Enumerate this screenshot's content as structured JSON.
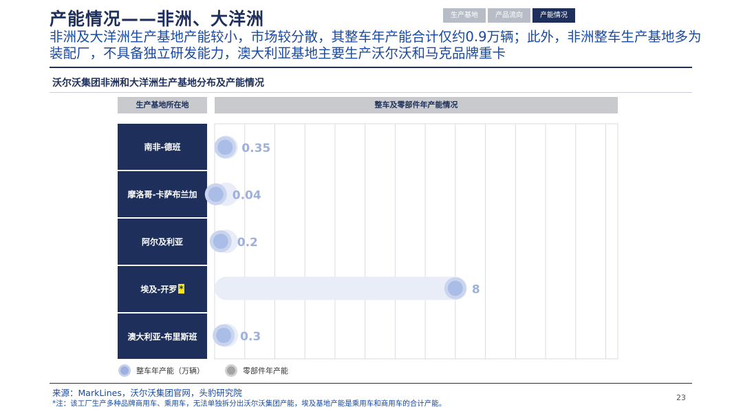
{
  "header": {
    "title": "产能情况——非洲、大洋洲",
    "nav_tabs": [
      {
        "label": "生产基地",
        "active": false
      },
      {
        "label": "产品流向",
        "active": false
      },
      {
        "label": "产能情况",
        "active": true
      }
    ],
    "subtitle": "非洲及大洋洲生产基地产能较小，市场较分散，其整车年产能合计仅约0.9万辆；此外，非洲整车生产基地多为装配厂，不具备独立研发能力，澳大利亚基地主要生产沃尔沃和马克品牌重卡"
  },
  "section_title": "沃尔沃集团非洲和大洋洲生产基地分布及产能情况",
  "table": {
    "col_left_header": "生产基地所在地",
    "col_right_header": "整车及零部件年产能情况"
  },
  "chart_data": {
    "type": "bar",
    "title": "",
    "xlabel": "",
    "ylabel": "",
    "categories": [
      "南非-德班",
      "摩洛哥-卡萨布兰加",
      "阿尔及利亚",
      "埃及-开罗",
      "澳大利亚-布里斯班"
    ],
    "category_notes": [
      "",
      "",
      "",
      "*",
      ""
    ],
    "series": [
      {
        "name": "整车年产能（万辆）",
        "values": [
          0.35,
          0.04,
          0.2,
          8,
          0.3
        ],
        "labels": [
          "0.35",
          "0.04",
          "0.2",
          "8",
          "0.3"
        ],
        "color": "#a9bde6"
      },
      {
        "name": "零部件年产能",
        "values": [],
        "labels": [],
        "color": "#a3a3a3"
      }
    ],
    "xlim": [
      0,
      13.4
    ],
    "grid": true,
    "legend_position": "bottom-left"
  },
  "legend": [
    {
      "label": "整车年产能（万辆）"
    },
    {
      "label": "零部件年产能"
    }
  ],
  "footer": {
    "source": "来源：MarkLines，沃尔沃集团官网，头豹研究院",
    "note": "*注：该工厂生产多种品牌商用车、乘用车，无法单独拆分出沃尔沃集团产能，埃及基地产能是乘用车和商用车的合计产能。",
    "page_number": "23"
  },
  "colors": {
    "navy": "#1d2f5a",
    "accent_blue": "#1a4aa0",
    "bubble": "#a9bde6",
    "header_gray": "#c8cacd"
  }
}
